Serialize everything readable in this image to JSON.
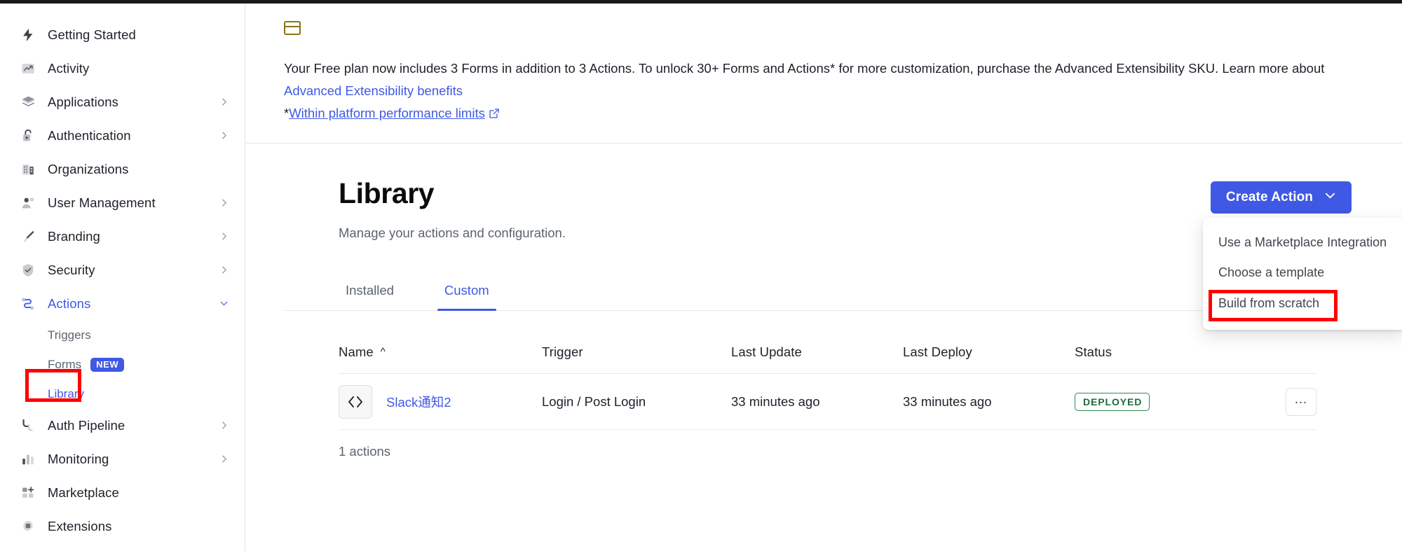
{
  "sidebar": {
    "items": [
      {
        "label": "Getting Started",
        "icon": "bolt-icon",
        "expandable": false,
        "active": false
      },
      {
        "label": "Activity",
        "icon": "activity-chart-icon",
        "expandable": false,
        "active": false
      },
      {
        "label": "Applications",
        "icon": "layers-icon",
        "expandable": true,
        "active": false
      },
      {
        "label": "Authentication",
        "icon": "lock-open-icon",
        "expandable": true,
        "active": false
      },
      {
        "label": "Organizations",
        "icon": "building-icon",
        "expandable": false,
        "active": false
      },
      {
        "label": "User Management",
        "icon": "user-gear-icon",
        "expandable": true,
        "active": false
      },
      {
        "label": "Branding",
        "icon": "paintbrush-icon",
        "expandable": true,
        "active": false
      },
      {
        "label": "Security",
        "icon": "shield-check-icon",
        "expandable": true,
        "active": false
      },
      {
        "label": "Actions",
        "icon": "actions-flow-icon",
        "expandable": true,
        "active": true
      }
    ],
    "sub_items": [
      {
        "label": "Triggers",
        "selected": false,
        "badge": ""
      },
      {
        "label": "Forms",
        "selected": false,
        "badge": "NEW"
      },
      {
        "label": "Library",
        "selected": true,
        "badge": ""
      }
    ],
    "items_after": [
      {
        "label": "Auth Pipeline",
        "icon": "pipeline-icon",
        "expandable": true,
        "active": false
      },
      {
        "label": "Monitoring",
        "icon": "bar-chart-icon",
        "expandable": true,
        "active": false
      },
      {
        "label": "Marketplace",
        "icon": "grid-plus-icon",
        "expandable": false,
        "active": false
      },
      {
        "label": "Extensions",
        "icon": "gear-chip-icon",
        "expandable": false,
        "active": false
      }
    ]
  },
  "banner": {
    "icon": "card-icon",
    "line1_part1": "Your Free plan now includes 3 Forms in addition to 3 Actions. To unlock 30+ Forms and Actions* for more customization, purchase the Advanced Extensibility SKU. Learn more about ",
    "link1": "Advanced Extensibility benefits",
    "asterisk": "*",
    "link2": "Within platform performance limits",
    "link2_icon": "external-link-icon"
  },
  "page": {
    "title": "Library",
    "subtitle": "Manage your actions and configuration."
  },
  "create_button": {
    "label": "Create Action",
    "caret_icon": "chevron-down-icon"
  },
  "create_menu": {
    "items": [
      {
        "label": "Use a Marketplace Integration",
        "highlighted": false
      },
      {
        "label": "Choose a template",
        "highlighted": false
      },
      {
        "label": "Build from scratch",
        "highlighted": true
      }
    ]
  },
  "tabs": [
    {
      "label": "Installed",
      "selected": false
    },
    {
      "label": "Custom",
      "selected": true
    }
  ],
  "table": {
    "columns": [
      "Name",
      "Trigger",
      "Last Update",
      "Last Deploy",
      "Status"
    ],
    "sort_column": "Name",
    "sort_caret": "^",
    "rows": [
      {
        "icon": "code-brackets-icon",
        "name": "Slack通知2",
        "trigger": "Login / Post Login",
        "last_update": "33 minutes ago",
        "last_deploy": "33 minutes ago",
        "status": "DEPLOYED",
        "menu_icon": "ellipsis-icon"
      }
    ],
    "footer": "1 actions"
  },
  "colors": {
    "accent": "#3f59e4",
    "status_deployed": "#1d6b38",
    "annotation": "#ff0000",
    "banner_icon": "#8a7318"
  }
}
